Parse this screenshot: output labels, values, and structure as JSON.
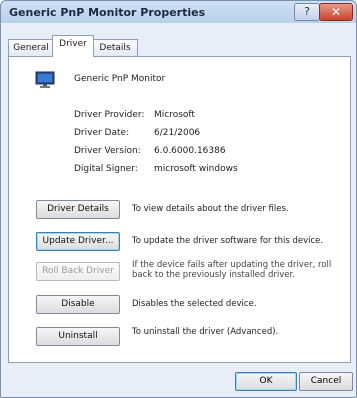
{
  "window": {
    "title": "Generic PnP Monitor Properties",
    "help_label": "?",
    "close_label": "✕"
  },
  "tabs": [
    {
      "label": "General",
      "active": false
    },
    {
      "label": "Driver",
      "active": true
    },
    {
      "label": "Details",
      "active": false
    }
  ],
  "device": {
    "icon": "monitor-icon",
    "name": "Generic PnP Monitor"
  },
  "info": [
    {
      "label": "Driver Provider:",
      "value": "Microsoft"
    },
    {
      "label": "Driver Date:",
      "value": "6/21/2006"
    },
    {
      "label": "Driver Version:",
      "value": "6.0.6000.16386"
    },
    {
      "label": "Digital Signer:",
      "value": "microsoft windows"
    }
  ],
  "actions": [
    {
      "label": "Driver Details",
      "desc": "To view details about the driver files.",
      "enabled": true
    },
    {
      "label": "Update Driver...",
      "desc": "To update the driver software for this device.",
      "enabled": true
    },
    {
      "label": "Roll Back Driver",
      "desc": "If the device fails after updating the driver, roll back to the previously installed driver.",
      "enabled": false
    },
    {
      "label": "Disable",
      "desc": "Disables the selected device.",
      "enabled": true
    },
    {
      "label": "Uninstall",
      "desc": "To uninstall the driver (Advanced).",
      "enabled": true
    }
  ],
  "footer": {
    "ok_label": "OK",
    "cancel_label": "Cancel"
  }
}
